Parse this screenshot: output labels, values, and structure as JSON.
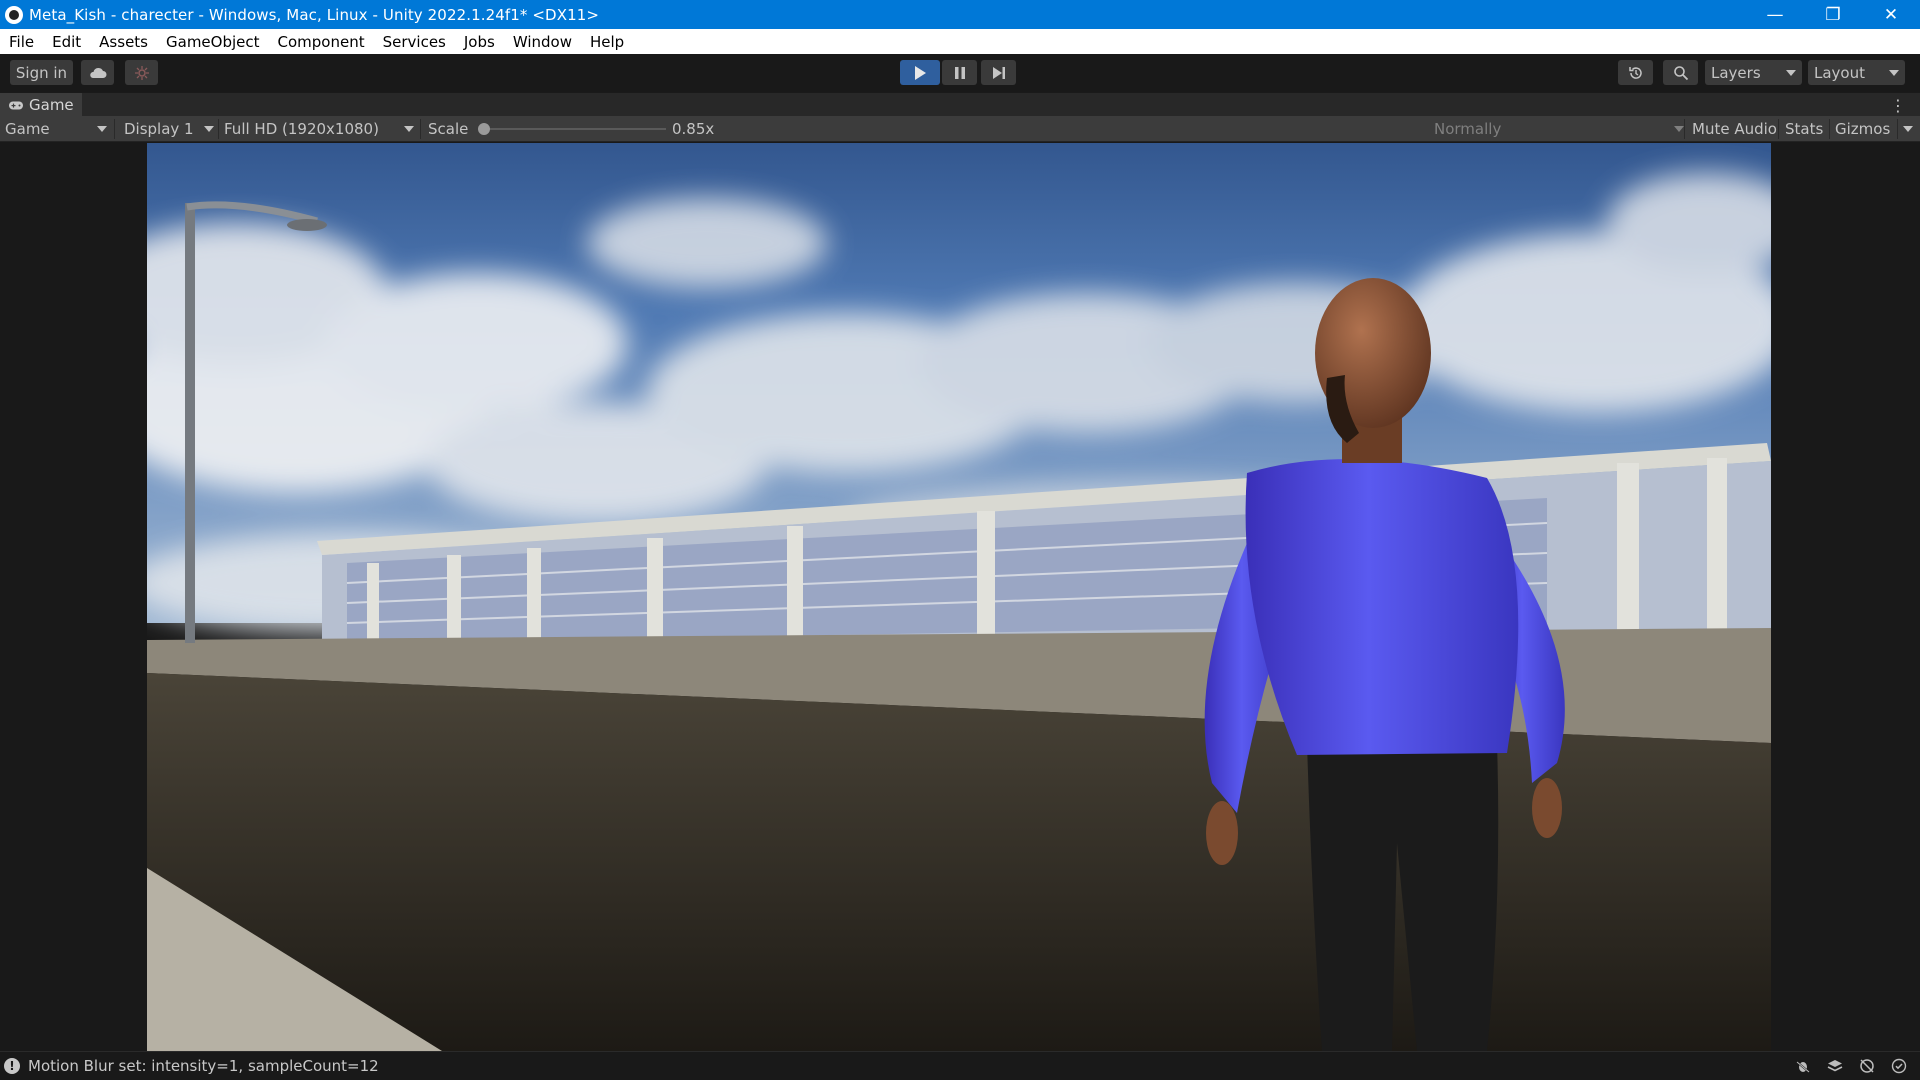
{
  "window": {
    "title": "Meta_Kish - charecter - Windows, Mac, Linux - Unity 2022.1.24f1* <DX11>",
    "controls": {
      "minimize": "—",
      "restore": "❐",
      "close": "✕"
    }
  },
  "menubar": {
    "items": [
      {
        "label": "File"
      },
      {
        "label": "Edit"
      },
      {
        "label": "Assets"
      },
      {
        "label": "GameObject"
      },
      {
        "label": "Component"
      },
      {
        "label": "Services"
      },
      {
        "label": "Jobs"
      },
      {
        "label": "Window"
      },
      {
        "label": "Help"
      }
    ]
  },
  "toolbar": {
    "sign_in_label": "Sign in",
    "icons": [
      "cloud-icon",
      "collab-icon",
      "play-icon",
      "pause-icon",
      "step-icon",
      "history-icon",
      "search-icon"
    ],
    "play_state": "playing",
    "layers_label": "Layers",
    "layout_label": "Layout"
  },
  "tabs": {
    "game_tab_label": "Game"
  },
  "gamebar": {
    "view_select": "Game",
    "display_select": "Display 1",
    "resolution_select": "Full HD (1920x1080)",
    "scale_label": "Scale",
    "scale_value_text": "0.85x",
    "scale_slider_fraction": 0.0,
    "play_mode_select": "Normally",
    "mute_audio_label": "Mute Audio",
    "stats_label": "Stats",
    "gizmos_label": "Gizmos"
  },
  "colors": {
    "title_bar": "#0078d7",
    "accent_play": "#2f5f9e",
    "editor_bg": "#191919",
    "sky": "#4f79b3",
    "shirt": "#4a4ad8"
  },
  "statusbar": {
    "message": "Motion Blur set: intensity=1, sampleCount=12",
    "icons": [
      "debug-icon",
      "layers-stack-icon",
      "network-icon",
      "check-icon"
    ]
  }
}
